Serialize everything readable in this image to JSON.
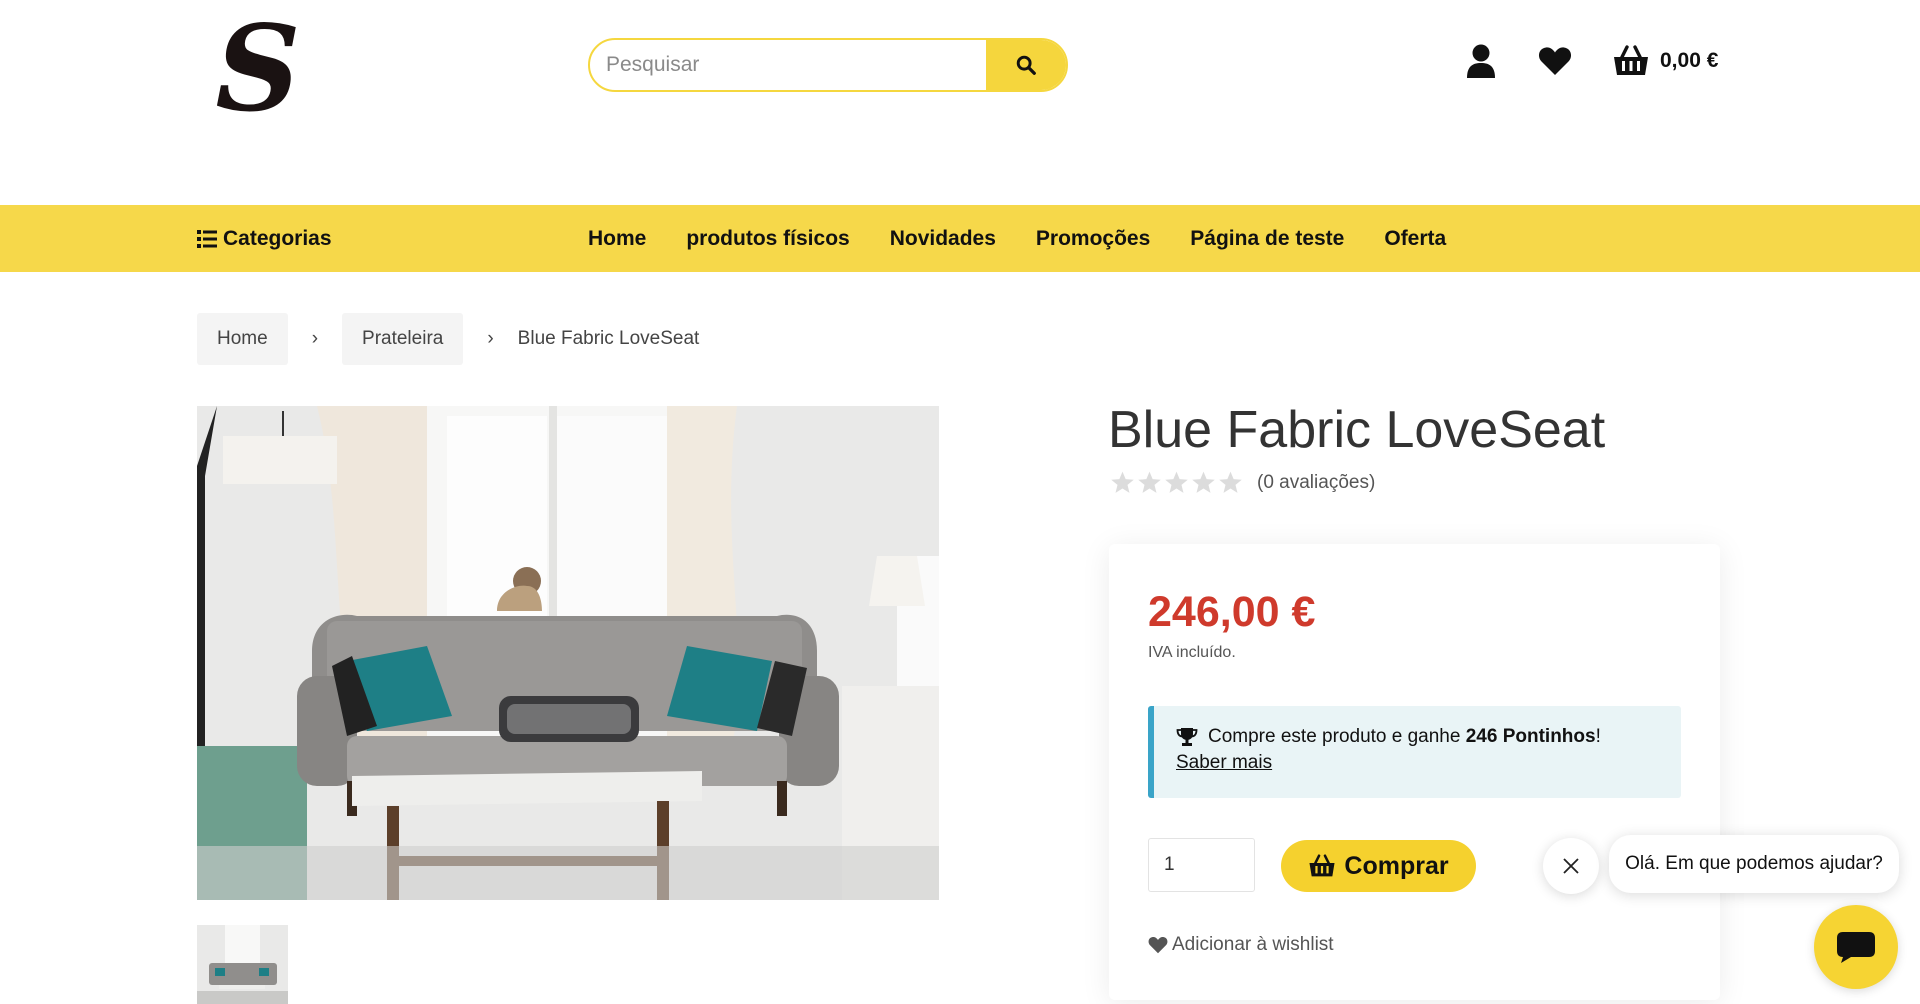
{
  "header": {
    "logo_text": "S",
    "search_placeholder": "Pesquisar",
    "cart_total": "0,00 €"
  },
  "nav": {
    "categories_label": "Categorias",
    "items": [
      {
        "label": "Home"
      },
      {
        "label": "produtos físicos"
      },
      {
        "label": "Novidades"
      },
      {
        "label": "Promoções"
      },
      {
        "label": "Página de teste"
      },
      {
        "label": "Oferta"
      }
    ]
  },
  "breadcrumb": {
    "home": "Home",
    "category": "Prateleira",
    "current": "Blue Fabric LoveSeat",
    "separator": "›"
  },
  "product": {
    "title": "Blue Fabric LoveSeat",
    "rating": 0,
    "rating_max": 5,
    "reviews": "(0 avaliações)",
    "price": "246,00 €",
    "vat_note": "IVA incluído.",
    "points_prefix": "Compre este produto e ganhe ",
    "points_value": "246 Pontinhos",
    "points_suffix": "!",
    "points_link": "Saber mais",
    "quantity": "1",
    "buy_label": "Comprar",
    "wishlist_label": "Adicionar à wishlist"
  },
  "chat": {
    "greeting": "Olá. Em que podemos ajudar?"
  },
  "colors": {
    "accent_yellow": "#f6d84a",
    "price_red": "#cf3a2c",
    "info_blue": "#3aa4c8"
  }
}
